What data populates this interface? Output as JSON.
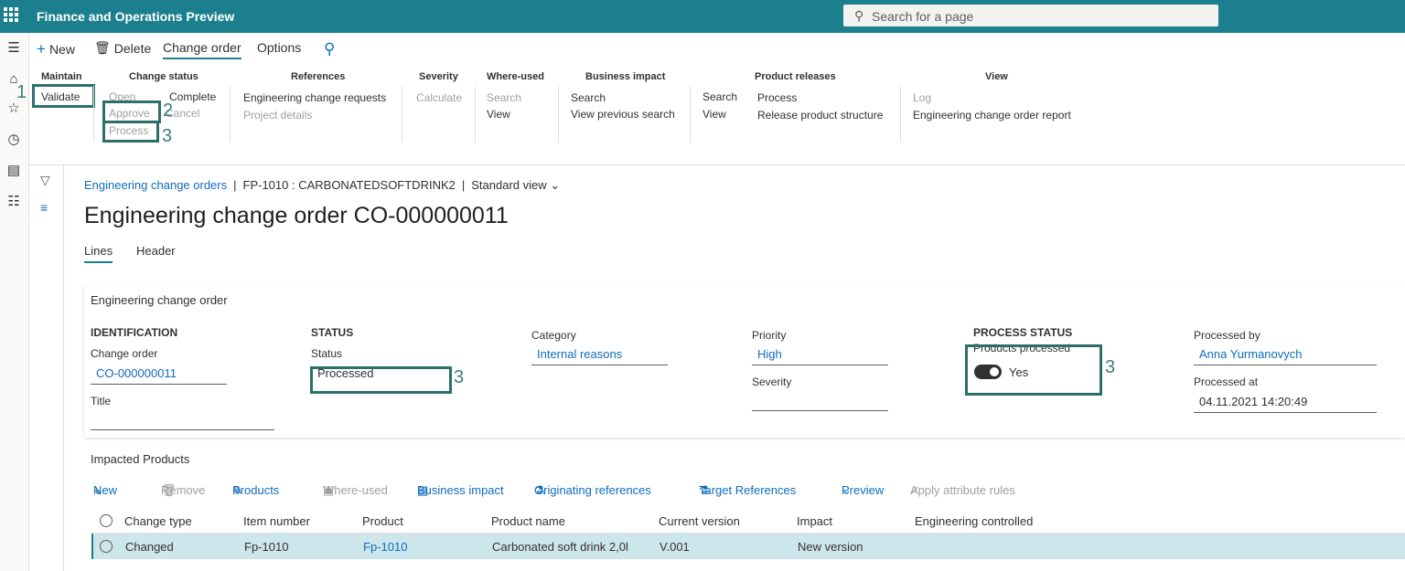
{
  "app": {
    "title": "Finance and Operations Preview",
    "search_placeholder": "Search for a page"
  },
  "toolbar": {
    "new": "New",
    "delete": "Delete",
    "change_order": "Change order",
    "options": "Options"
  },
  "groups": {
    "maintain": {
      "header": "Maintain",
      "validate": "Validate"
    },
    "change_status": {
      "header": "Change status",
      "open": "Open",
      "complete": "Complete",
      "approve": "Approve",
      "cancel": "Cancel",
      "process": "Process"
    },
    "references": {
      "header": "References",
      "ecr": "Engineering change requests",
      "project": "Project details"
    },
    "severity": {
      "header": "Severity",
      "calculate": "Calculate"
    },
    "where_used": {
      "header": "Where-used",
      "search": "Search",
      "view": "View"
    },
    "business_impact": {
      "header": "Business impact",
      "search": "Search",
      "view_prev": "View previous search"
    },
    "product_releases": {
      "header": "Product releases",
      "search": "Search",
      "view": "View",
      "process": "Process",
      "release_structure": "Release product structure"
    },
    "view": {
      "header": "View",
      "log": "Log",
      "report": "Engineering change order report"
    }
  },
  "annotations": {
    "a1": "1",
    "a2": "2",
    "a3": "3",
    "a4": "3",
    "a5": "3"
  },
  "breadcrumb": {
    "link": "Engineering change orders",
    "sep1": "|",
    "record": "FP-1010 : CARBONATEDSOFTDRINK2",
    "sep2": "|",
    "view": "Standard view"
  },
  "page": {
    "title": "Engineering change order CO-000000011",
    "tab_lines": "Lines",
    "tab_header": "Header"
  },
  "card": {
    "title": "Engineering change order",
    "identification": "IDENTIFICATION",
    "change_order_label": "Change order",
    "change_order_value": "CO-000000011",
    "title_label": "Title",
    "status_header": "STATUS",
    "status_label": "Status",
    "status_value": "Processed",
    "category_label": "Category",
    "category_value": "Internal reasons",
    "priority_label": "Priority",
    "priority_value": "High",
    "severity_label": "Severity",
    "process_status_header": "PROCESS STATUS",
    "products_processed_label": "Products processed",
    "products_processed_value": "Yes",
    "processed_by_label": "Processed by",
    "processed_by_value": "Anna Yurmanovych",
    "processed_at_label": "Processed at",
    "processed_at_value": "04.11.2021 14:20:49"
  },
  "impacted": {
    "title": "Impacted Products",
    "toolbar": {
      "new": "New",
      "remove": "Remove",
      "products": "Products",
      "where_used": "Where-used",
      "business_impact": "Business impact",
      "originating": "Originating references",
      "target": "Target References",
      "preview": "Preview",
      "apply": "Apply attribute rules"
    },
    "columns": [
      "Change type",
      "Item number",
      "Product",
      "Product name",
      "Current version",
      "Impact",
      "Engineering controlled"
    ],
    "rows": [
      {
        "change_type": "Changed",
        "item_number": "Fp-1010",
        "product": "Fp-1010",
        "product_name": "Carbonated soft drink 2,0l",
        "current_version": "V.001",
        "impact": "New version",
        "engineering_controlled": ""
      }
    ]
  }
}
